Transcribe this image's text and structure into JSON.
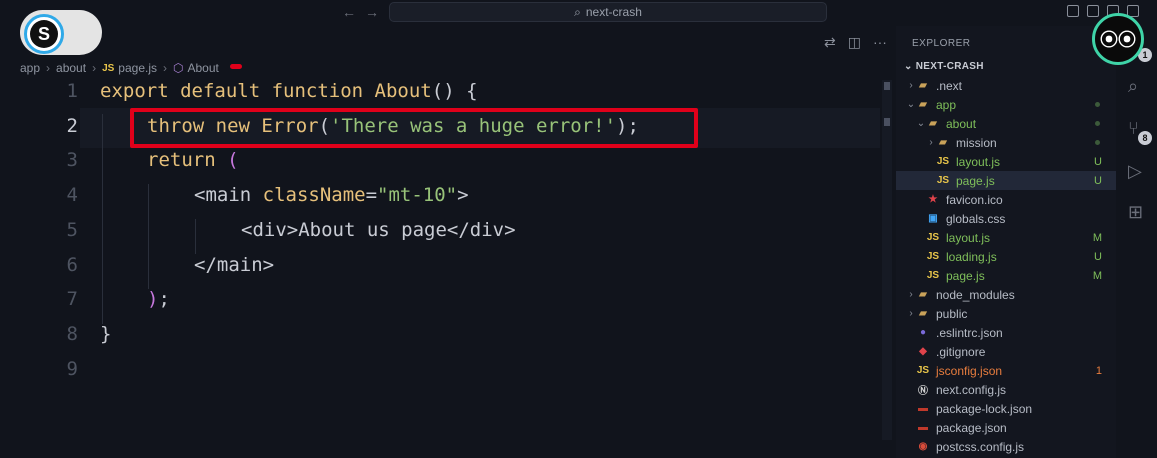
{
  "titlebar": {
    "search_label": "next-crash",
    "back_arrow": "←",
    "forward_arrow": "→"
  },
  "logo": {
    "letter": "S"
  },
  "breadcrumb": {
    "segments": [
      "app",
      "about",
      "page.js",
      "About"
    ],
    "js_tag": "JS"
  },
  "code": {
    "lines": [
      {
        "number": "1",
        "parts": [
          [
            "kw",
            "export default function "
          ],
          [
            "fn",
            "About"
          ],
          [
            "pu",
            "() {"
          ]
        ]
      },
      {
        "number": "2",
        "parts": [
          [
            "kw",
            "throw new "
          ],
          [
            "fn",
            "Error"
          ],
          [
            "pu",
            "("
          ],
          [
            "str",
            "'There was a huge error!'"
          ],
          [
            "pu",
            ");"
          ]
        ]
      },
      {
        "number": "3",
        "parts": [
          [
            "kw",
            "return "
          ],
          [
            "br-paren",
            "("
          ]
        ]
      },
      {
        "number": "4",
        "parts": [
          [
            "tag",
            "<main "
          ],
          [
            "attr",
            "className"
          ],
          [
            "pu",
            "="
          ],
          [
            "str",
            "\"mt-10\""
          ],
          [
            "tag",
            ">"
          ]
        ]
      },
      {
        "number": "5",
        "parts": [
          [
            "tag",
            "<div>About us page</div>"
          ]
        ]
      },
      {
        "number": "6",
        "parts": [
          [
            "tag",
            "</main>"
          ]
        ]
      },
      {
        "number": "7",
        "parts": [
          [
            "br-paren",
            ")"
          ],
          [
            "pu",
            ";"
          ]
        ]
      },
      {
        "number": "8",
        "parts": [
          [
            "pu",
            "}"
          ]
        ]
      },
      {
        "number": "9",
        "parts": []
      }
    ],
    "active_line": "2"
  },
  "explorer": {
    "title": "EXPLORER",
    "project": "NEXT-CRASH",
    "items": [
      {
        "label": ".next",
        "icon": "folder-icon"
      },
      {
        "label": "app",
        "icon": "folder-icon"
      },
      {
        "label": "about",
        "icon": "folder-icon"
      },
      {
        "label": "mission",
        "icon": "folder-icon"
      },
      {
        "label": "layout.js",
        "icon": "js-icon",
        "badge": "U"
      },
      {
        "label": "page.js",
        "icon": "js-icon",
        "badge": "U"
      },
      {
        "label": "favicon.ico",
        "icon": "favicon-icon"
      },
      {
        "label": "globals.css",
        "icon": "css-icon"
      },
      {
        "label": "layout.js",
        "icon": "js-icon",
        "badge": "M"
      },
      {
        "label": "loading.js",
        "icon": "js-icon",
        "badge": "U"
      },
      {
        "label": "page.js",
        "icon": "js-icon",
        "badge": "M"
      },
      {
        "label": "node_modules",
        "icon": "folder-icon"
      },
      {
        "label": "public",
        "icon": "folder-icon"
      },
      {
        "label": ".eslintrc.json",
        "icon": "eslint-icon"
      },
      {
        "label": ".gitignore",
        "icon": "git-icon"
      },
      {
        "label": "jsconfig.json",
        "icon": "js-icon",
        "badge": "1"
      },
      {
        "label": "next.config.js",
        "icon": "next-icon"
      },
      {
        "label": "package-lock.json",
        "icon": "npm-icon"
      },
      {
        "label": "package.json",
        "icon": "npm-icon"
      },
      {
        "label": "postcss.config.js",
        "icon": "postcss-icon"
      }
    ]
  },
  "activity": {
    "explorer_badge": "1",
    "scm_badge": "8"
  },
  "colors": {
    "highlight": "#e0001a",
    "accent_green": "#7fbf5a",
    "error_orange": "#e87d3e"
  }
}
